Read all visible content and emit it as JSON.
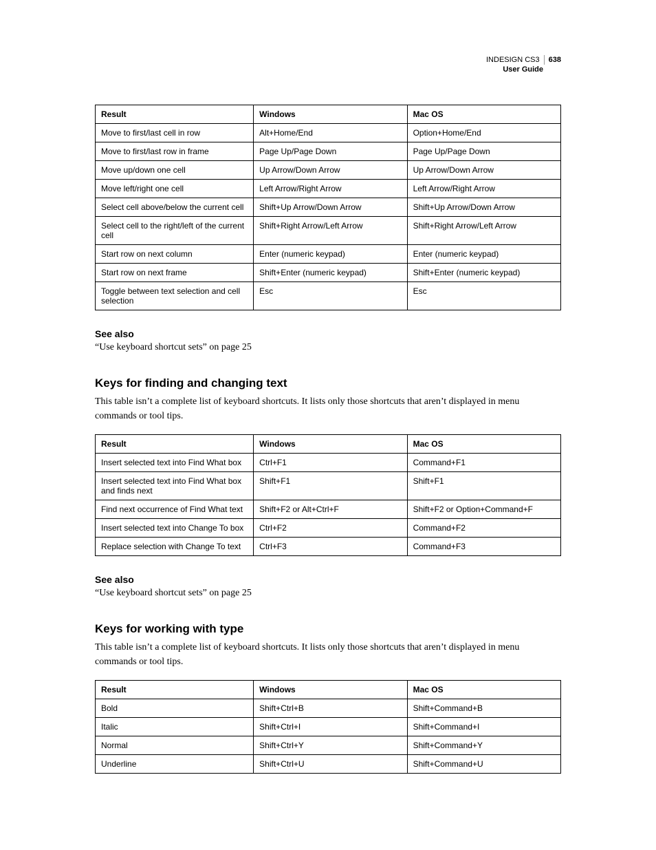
{
  "header": {
    "product": "INDESIGN CS3",
    "guide": "User Guide",
    "page_number": "638"
  },
  "сolumn_headers": {
    "result": "Result",
    "windows": "Windows",
    "macos": "Mac OS"
  },
  "table1_rows": [
    {
      "r": "Move to first/last cell in row",
      "w": "Alt+Home/End",
      "m": "Option+Home/End"
    },
    {
      "r": "Move to first/last row in frame",
      "w": "Page Up/Page Down",
      "m": "Page Up/Page Down"
    },
    {
      "r": "Move up/down one cell",
      "w": "Up Arrow/Down Arrow",
      "m": "Up Arrow/Down Arrow"
    },
    {
      "r": "Move left/right one cell",
      "w": "Left Arrow/Right Arrow",
      "m": "Left Arrow/Right Arrow"
    },
    {
      "r": "Select cell above/below the current cell",
      "w": "Shift+Up Arrow/Down Arrow",
      "m": "Shift+Up Arrow/Down Arrow"
    },
    {
      "r": "Select cell to the right/left of the current cell",
      "w": "Shift+Right Arrow/Left Arrow",
      "m": "Shift+Right Arrow/Left Arrow"
    },
    {
      "r": "Start row on next column",
      "w": "Enter (numeric keypad)",
      "m": "Enter (numeric keypad)"
    },
    {
      "r": "Start row on next frame",
      "w": "Shift+Enter (numeric keypad)",
      "m": "Shift+Enter (numeric keypad)"
    },
    {
      "r": "Toggle between text selection and cell selection",
      "w": "Esc",
      "m": "Esc"
    }
  ],
  "see_also_heading": "See also",
  "see_also_link": "“Use keyboard shortcut sets” on page 25",
  "section2": {
    "title": "Keys for finding and changing text",
    "intro": "This table isn’t a complete list of keyboard shortcuts. It lists only those shortcuts that aren’t displayed in menu commands or tool tips.",
    "rows": [
      {
        "r": "Insert selected text into Find What box",
        "w": "Ctrl+F1",
        "m": "Command+F1"
      },
      {
        "r": "Insert selected text into Find What box and finds next",
        "w": "Shift+F1",
        "m": "Shift+F1"
      },
      {
        "r": "Find next occurrence of Find What text",
        "w": "Shift+F2 or Alt+Ctrl+F",
        "m": "Shift+F2 or Option+Command+F"
      },
      {
        "r": "Insert selected text into Change To box",
        "w": "Ctrl+F2",
        "m": "Command+F2"
      },
      {
        "r": "Replace selection with Change To text",
        "w": "Ctrl+F3",
        "m": "Command+F3"
      }
    ]
  },
  "section3": {
    "title": "Keys for working with type",
    "intro": "This table isn’t a complete list of keyboard shortcuts. It lists only those shortcuts that aren’t displayed in menu commands or tool tips.",
    "rows": [
      {
        "r": "Bold",
        "w": "Shift+Ctrl+B",
        "m": "Shift+Command+B"
      },
      {
        "r": "Italic",
        "w": "Shift+Ctrl+I",
        "m": "Shift+Command+I"
      },
      {
        "r": "Normal",
        "w": "Shift+Ctrl+Y",
        "m": "Shift+Command+Y"
      },
      {
        "r": "Underline",
        "w": "Shift+Ctrl+U",
        "m": "Shift+Command+U"
      }
    ]
  }
}
